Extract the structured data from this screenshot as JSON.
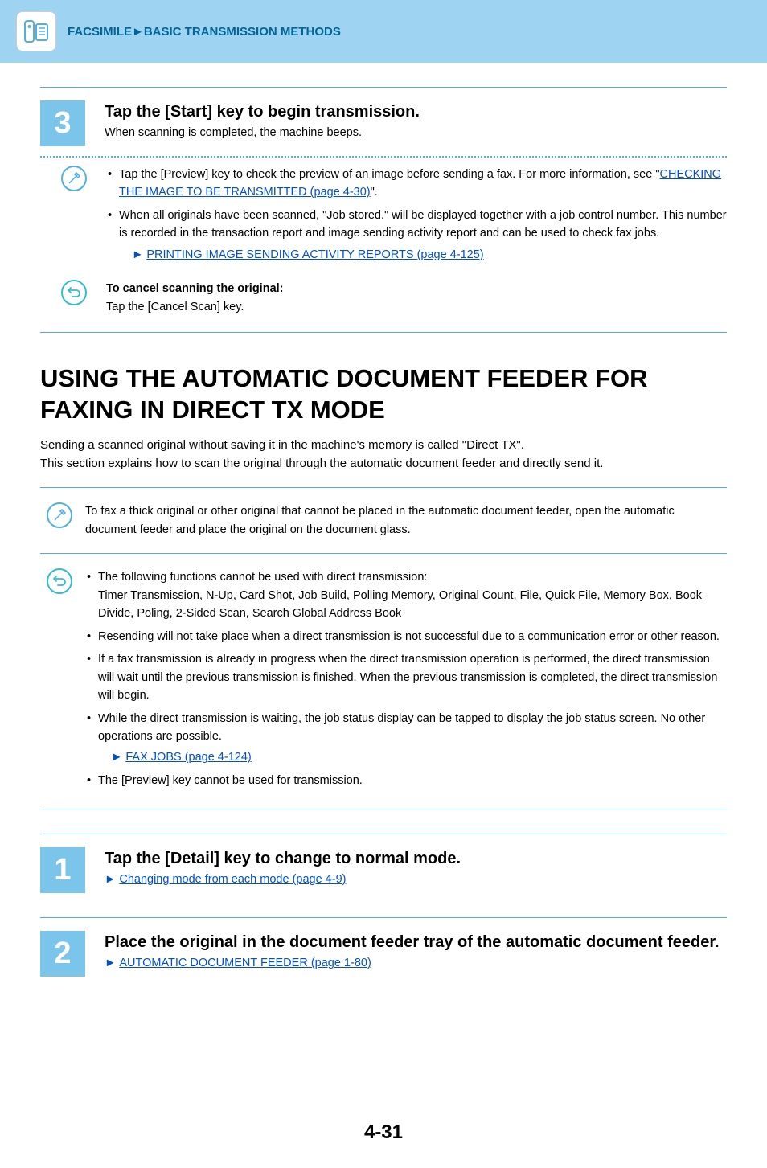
{
  "header": {
    "breadcrumb": "FACSIMILE►BASIC TRANSMISSION METHODS"
  },
  "step3": {
    "num": "3",
    "title": "Tap the [Start] key to begin transmission.",
    "desc": "When scanning is completed, the machine beeps.",
    "bullet1_pre": "Tap the [Preview] key to check the preview of an image before sending a fax. For more information, see \"",
    "bullet1_link": "CHECKING THE IMAGE TO BE TRANSMITTED (page 4-30)",
    "bullet1_post": "\".",
    "bullet2": "When all originals have been scanned, \"Job stored.\" will be displayed together with a job control number. This number is recorded in the transaction report and image sending activity report and can be used to check fax jobs.",
    "bullet2_link": "PRINTING IMAGE SENDING ACTIVITY REPORTS (page 4-125)",
    "cancel_title": "To cancel scanning the original:",
    "cancel_desc": "Tap the [Cancel Scan] key."
  },
  "h1": "USING THE AUTOMATIC DOCUMENT FEEDER FOR FAXING IN DIRECT TX MODE",
  "intro1": "Sending a scanned original without saving it in the machine's memory is called \"Direct TX\".",
  "intro2": "This section explains how to scan the original through the automatic document feeder and directly send it.",
  "note1": "To fax a thick original or other original that cannot be placed in the automatic document feeder, open the automatic document feeder and place the original on the document glass.",
  "caution": {
    "b1": "The following functions cannot be used with direct transmission:",
    "b1_sub": "Timer Transmission, N-Up, Card Shot, Job Build, Polling Memory, Original Count, File, Quick File, Memory Box, Book Divide, Poling, 2-Sided Scan, Search Global Address Book",
    "b2": "Resending will not take place when a direct transmission is not successful due to a communication error or other reason.",
    "b3": "If a fax transmission is already in progress when the direct transmission operation is performed, the direct transmission will wait until the previous transmission is finished. When the previous transmission is completed, the direct transmission will begin.",
    "b4": "While the direct transmission is waiting, the job status display can be tapped to display the job status screen. No other operations are possible.",
    "b4_link": "FAX JOBS (page 4-124)",
    "b5": "The [Preview] key cannot be used for transmission."
  },
  "step1": {
    "num": "1",
    "title": "Tap the [Detail] key to change to normal mode.",
    "link": "Changing mode from each mode (page 4-9)"
  },
  "step2": {
    "num": "2",
    "title": "Place the original in the document feeder tray of the automatic document feeder.",
    "link": "AUTOMATIC DOCUMENT FEEDER (page 1-80)"
  },
  "page_num": "4-31"
}
